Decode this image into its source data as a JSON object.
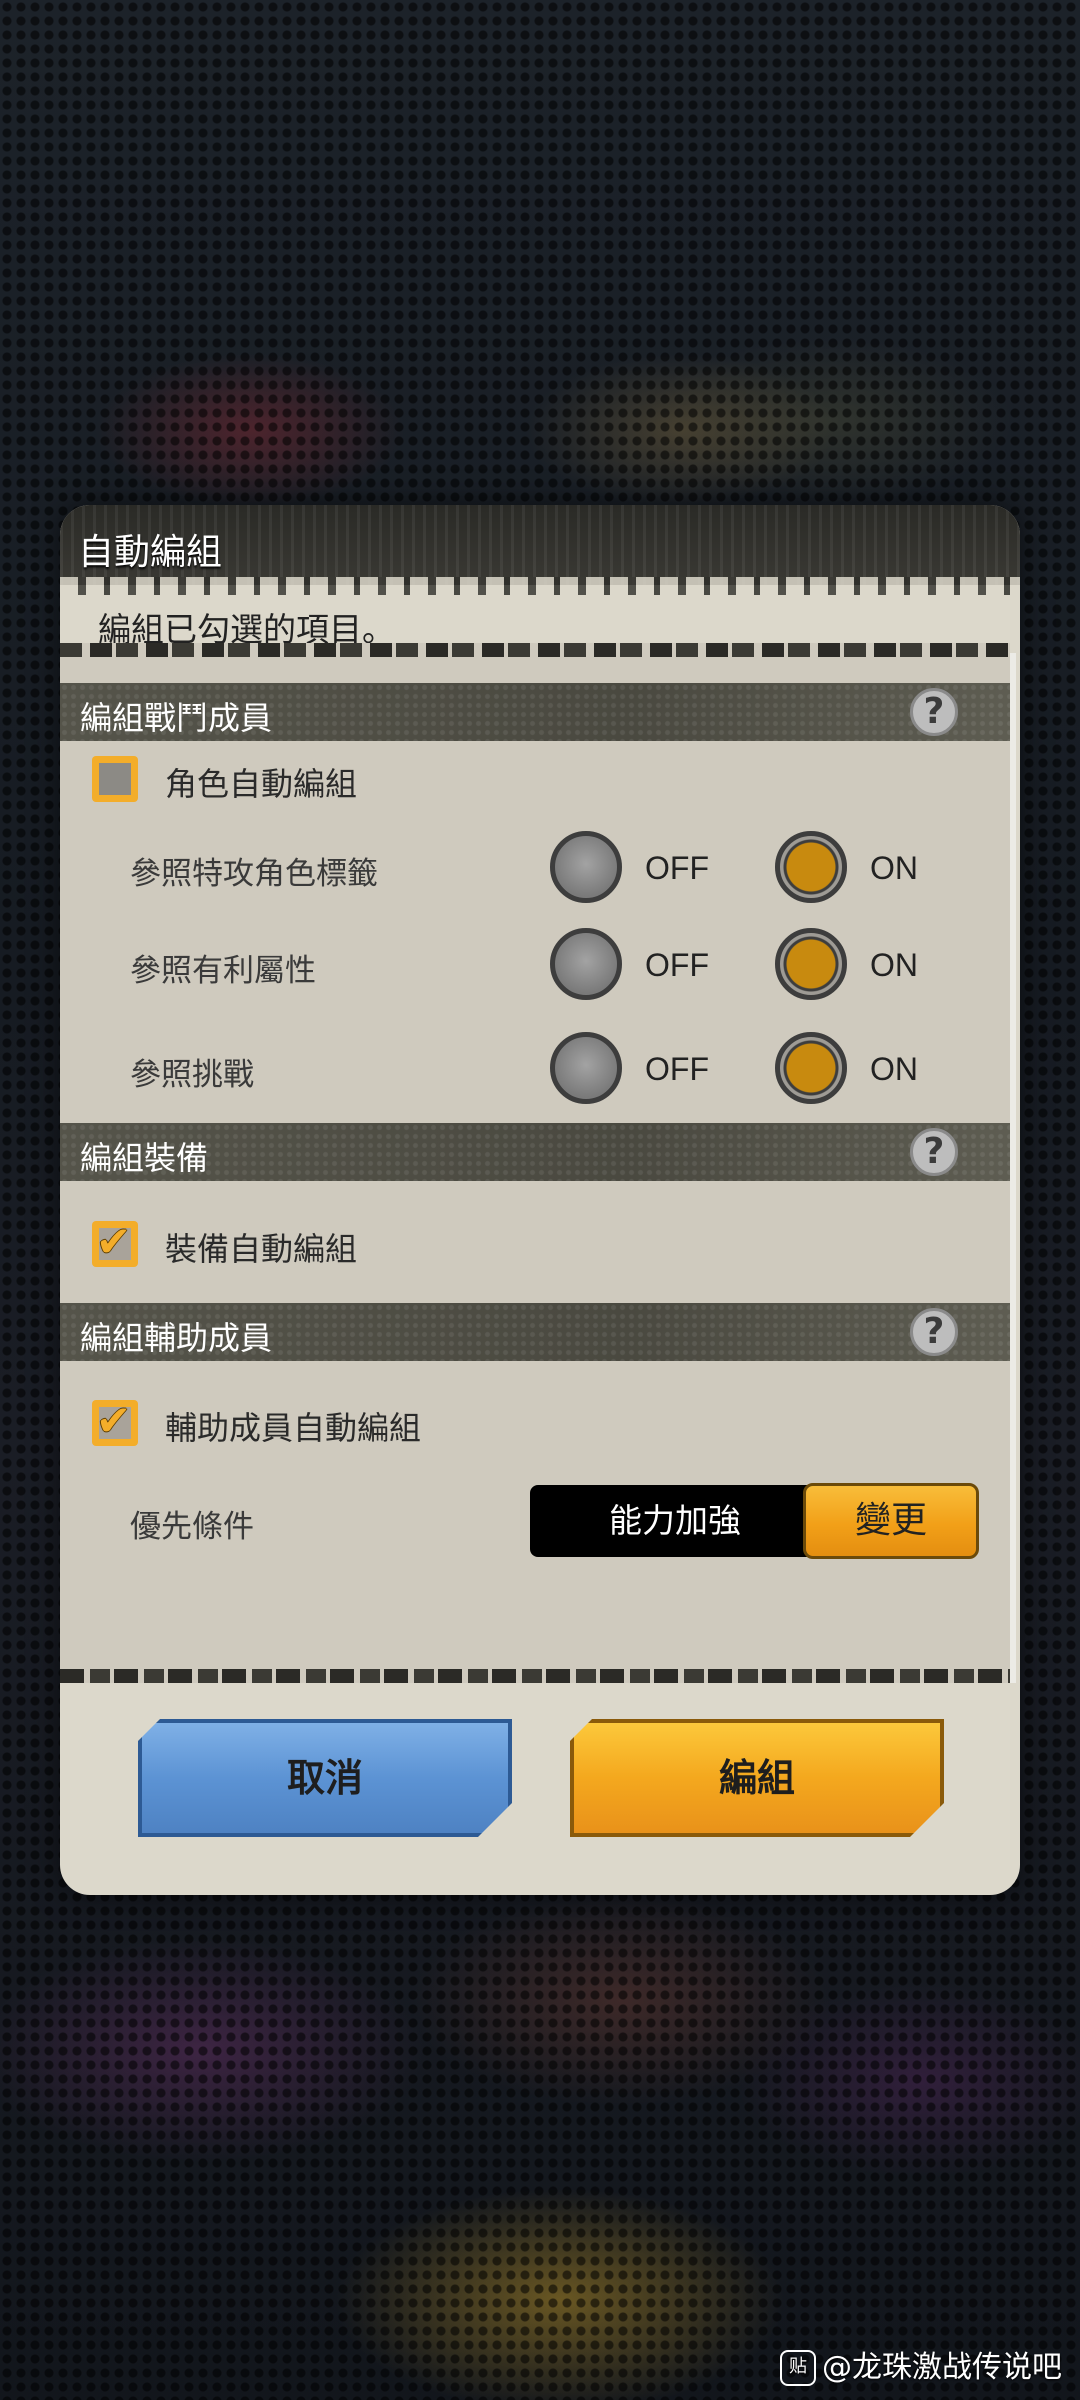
{
  "dialog": {
    "title": "自動編組",
    "subtitle": "編組已勾選的項目。"
  },
  "sections": {
    "battle_members": {
      "label": "編組戰鬥成員",
      "checkbox_label": "角色自動編組",
      "checked": false,
      "options": [
        {
          "label": "參照特攻角色標籤",
          "off_label": "OFF",
          "on_label": "ON",
          "selected": "ON"
        },
        {
          "label": "參照有利屬性",
          "off_label": "OFF",
          "on_label": "ON",
          "selected": "ON"
        },
        {
          "label": "參照挑戰",
          "off_label": "OFF",
          "on_label": "ON",
          "selected": "ON"
        }
      ]
    },
    "equipment": {
      "label": "編組裝備",
      "checkbox_label": "裝備自動編組",
      "checked": true
    },
    "support_members": {
      "label": "編組輔助成員",
      "checkbox_label": "輔助成員自動編組",
      "checked": true,
      "priority_label": "優先條件",
      "priority_value": "能力加強",
      "change_label": "變更"
    }
  },
  "help_icon_text": "?",
  "buttons": {
    "cancel": "取消",
    "confirm": "編組"
  },
  "watermark": {
    "logo": "贴",
    "text": "@龙珠激战传说吧"
  },
  "colors": {
    "accent_orange": "#f3ad2a",
    "cancel_blue": "#5c93d4",
    "dialog_bg": "#dcd8cb"
  }
}
